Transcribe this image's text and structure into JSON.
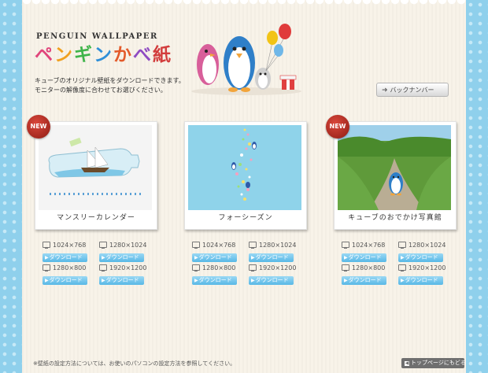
{
  "header": {
    "logo_subtitle": "PENGUIN WALLPAPER",
    "logo_title_chars": [
      "ペ",
      "ン",
      "ギ",
      "ン",
      "か",
      "べ",
      "紙"
    ],
    "logo_title_colors": [
      "#e0457b",
      "#f0a020",
      "#3fb44a",
      "#2f8fd8",
      "#e35a2a",
      "#8f4bc2",
      "#d23c3c"
    ],
    "intro_lines": [
      "キューブのオリジナル壁紙をダウンロードできます。",
      "モニターの解像度に合わせてお選びください。"
    ],
    "back_number_label": "バックナンバー"
  },
  "cards": [
    {
      "title": "マンスリーカレンダー",
      "is_new": true,
      "new_label": "NEW",
      "thumb_kind": "bottle",
      "downloads": [
        {
          "res": "1024×768",
          "label": "ダウンロード"
        },
        {
          "res": "1280×1024",
          "label": "ダウンロード"
        },
        {
          "res": "1280×800",
          "label": "ダウンロード"
        },
        {
          "res": "1920×1200",
          "label": "ダウンロード"
        }
      ]
    },
    {
      "title": "フォーシーズン",
      "is_new": false,
      "new_label": "",
      "thumb_kind": "seasons",
      "downloads": [
        {
          "res": "1024×768",
          "label": "ダウンロード"
        },
        {
          "res": "1280×1024",
          "label": "ダウンロード"
        },
        {
          "res": "1280×800",
          "label": "ダウンロード"
        },
        {
          "res": "1920×1200",
          "label": "ダウンロード"
        }
      ]
    },
    {
      "title": "キューブのおでかけ写真館",
      "is_new": true,
      "new_label": "NEW",
      "thumb_kind": "photo",
      "downloads": [
        {
          "res": "1024×768",
          "label": "ダウンロード"
        },
        {
          "res": "1280×1024",
          "label": "ダウンロード"
        },
        {
          "res": "1280×800",
          "label": "ダウンロード"
        },
        {
          "res": "1920×1200",
          "label": "ダウンロード"
        }
      ]
    }
  ],
  "footer": {
    "note": "※壁紙の設定方法については、お使いのパソコンの設定方法を参照してください。",
    "top_link_label": "トップページにもどる"
  },
  "colors": {
    "side_blue": "#8fd0ec",
    "panel_cream": "#f8f3e9",
    "download_blue": "#58b8e6",
    "new_red": "#b8281e"
  }
}
